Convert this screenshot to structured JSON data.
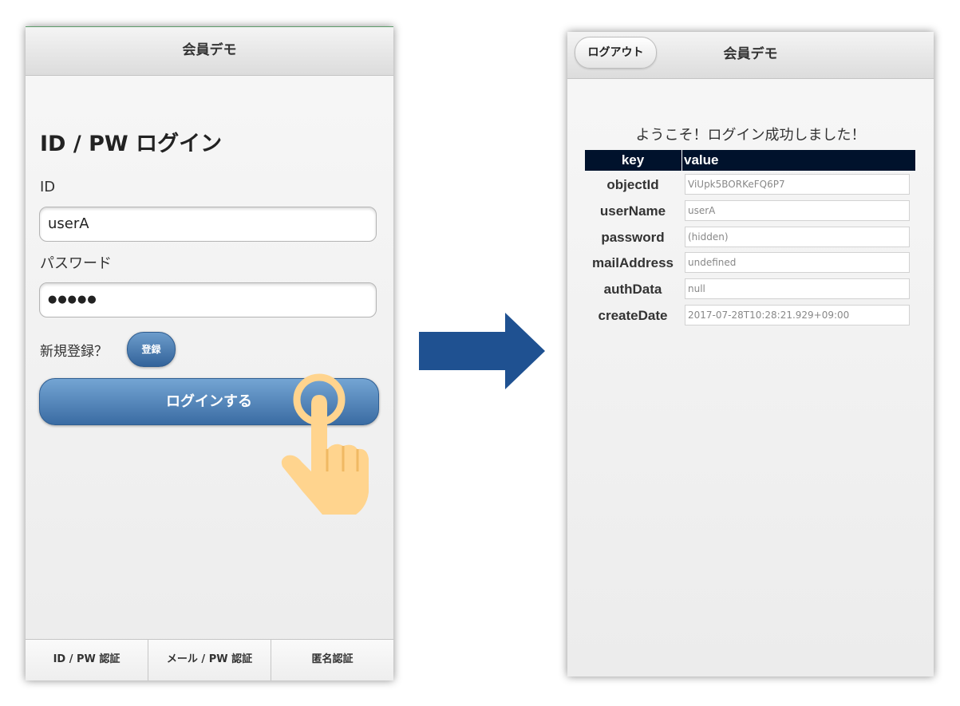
{
  "login_screen": {
    "header_title": "会員デモ",
    "login_title": "ID / PW ログイン",
    "id_label": "ID",
    "id_value": "userA",
    "password_label": "パスワード",
    "password_value": "●●●●●",
    "signup_question": "新規登録？",
    "signup_button": "登録",
    "login_button": "ログインする",
    "footer_tabs": [
      "ID / PW 認証",
      "メール / PW 認証",
      "匿名認証"
    ]
  },
  "result_screen": {
    "header_title": "会員デモ",
    "logout_button": "ログアウト",
    "welcome_message": "ようこそ！ログイン成功しました！",
    "table_headers": {
      "key": "key",
      "value": "value"
    },
    "rows": [
      {
        "key": "objectId",
        "value": "ViUpk5BORKeFQ6P7"
      },
      {
        "key": "userName",
        "value": "userA"
      },
      {
        "key": "password",
        "value": "(hidden)"
      },
      {
        "key": "mailAddress",
        "value": "undefined"
      },
      {
        "key": "authData",
        "value": "null"
      },
      {
        "key": "createDate",
        "value": "2017-07-28T10:28:21.929+09:00"
      }
    ]
  },
  "colors": {
    "button_blue": "#3a6ca3",
    "arrow_blue": "#1f5191",
    "table_header": "#00122c",
    "hand_fill": "#ffd48e"
  },
  "icons": [
    "tap-hand-icon",
    "right-arrow-icon"
  ]
}
